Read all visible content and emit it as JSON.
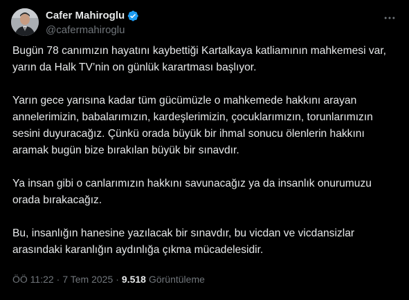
{
  "author": {
    "display_name": "Cafer Mahiroglu",
    "handle": "@cafermahiroglu",
    "verified_color": "#1d9bf0"
  },
  "tweet": {
    "paragraphs": [
      "Bugün 78 canımızın hayatını kaybettiği Kartalkaya katliamının mahkemesi var, yarın da Halk TV’nin on günlük karartması başlıyor.",
      "Yarın gece yarısına kadar tüm gücümüzle o mahkemede hakkını arayan annelerimizin, babalarımızın, kardeşlerimizin, çocuklarımızın, torunlarımızın sesini duyuracağız. Çünkü orada büyük bir ihmal sonucu ölenlerin hakkını aramak bugün bize bırakılan büyük bir sınavdır.",
      "Ya insan gibi o canlarımızın hakkını savunacağız ya da insanlık onurumuzu orada bırakacağız.",
      "Bu, insanlığın hanesine yazılacak bir sınavdır, bu vicdan ve vicdansizlar arasındaki karanlığın aydınlığa çıkma mücadelesidir."
    ]
  },
  "meta": {
    "time": "ÖÖ 11:22",
    "separator": "·",
    "date": "7 Tem 2025",
    "views_count": "9.518",
    "views_label": "Görüntüleme"
  },
  "icons": {
    "more": "more-horizontal-icon",
    "verified": "verified-badge-icon"
  },
  "colors": {
    "background": "#000000",
    "text": "#e7e9ea",
    "secondary": "#71767b",
    "accent": "#1d9bf0"
  }
}
